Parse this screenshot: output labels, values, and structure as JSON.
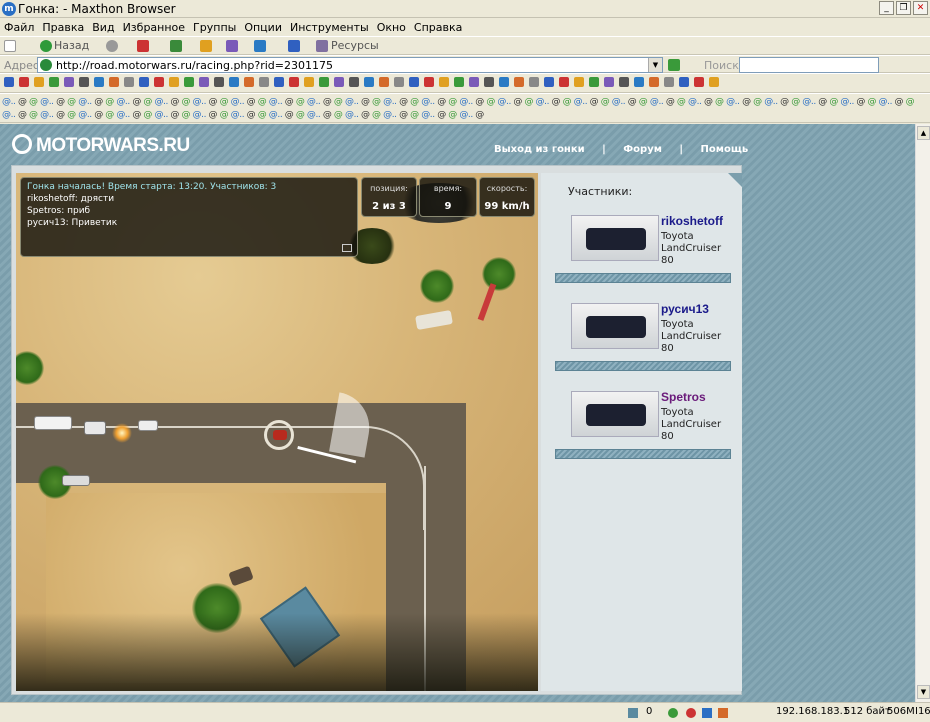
{
  "window": {
    "title": "Гонка: - Maxthon Browser",
    "controls": [
      "_",
      "❐",
      "✕"
    ],
    "accent": "#2a6fc4"
  },
  "menu": [
    "Файл",
    "Правка",
    "Вид",
    "Избранное",
    "Группы",
    "Опции",
    "Инструменты",
    "Окно",
    "Справка"
  ],
  "toolbar": {
    "back_label": "Назад",
    "resources_label": "Ресурсы"
  },
  "address": {
    "label": "Адрес",
    "url": "http://road.motorwars.ru/racing.php?rid=2301175",
    "search_label": "Поиск",
    "search_value": ""
  },
  "page": {
    "logo": "MOTORWARS.RU",
    "nav": [
      "Выход из гонки",
      "Форум",
      "Помощь"
    ],
    "nav_separator": "|",
    "chat": {
      "system": "Гонка началась! Время старта: 13:20. Участников: 3",
      "lines": [
        {
          "user": "rikoshetoff:",
          "text": "дрясти"
        },
        {
          "user": "Spetros:",
          "text": "приб"
        },
        {
          "user": "русич13:",
          "text": "Приветик"
        }
      ]
    },
    "stats": [
      {
        "label": "позиция:",
        "value": "2 из 3"
      },
      {
        "label": "время:",
        "value": "9"
      },
      {
        "label": "скорость:",
        "value": "99 km/h"
      }
    ],
    "participants_heading": "Участники:",
    "participants": [
      {
        "name": "rikoshetoff",
        "car": "Toyota LandCruiser 80",
        "color": "#1a1a8a"
      },
      {
        "name": "русич13",
        "car": "Toyota LandCruiser 80",
        "color": "#1a1a8a"
      },
      {
        "name": "Spetros",
        "car": "Toyota LandCruiser 80",
        "color": "#6a1a7a"
      }
    ]
  },
  "status": {
    "count": "0",
    "ip": "192.168.183.1",
    "bytes": "512 байт",
    "memory": "506M",
    "extra": "I16"
  }
}
